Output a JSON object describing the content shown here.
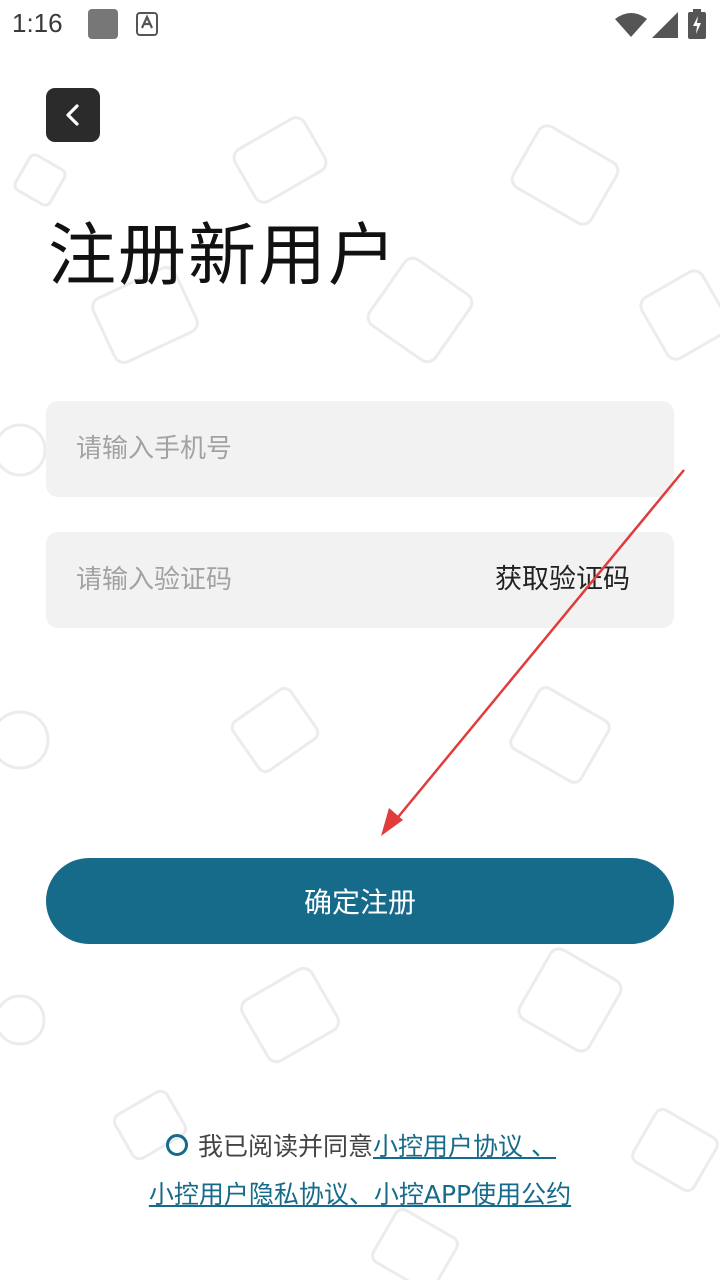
{
  "status_bar": {
    "time": "1:16"
  },
  "header": {
    "back_icon": "chevron-left-icon",
    "title": "注册新用户"
  },
  "form": {
    "phone_placeholder": "请输入手机号",
    "code_placeholder": "请输入验证码",
    "get_code_label": "获取验证码",
    "submit_label": "确定注册"
  },
  "agreement": {
    "prefix": "我已阅读并同意",
    "link1": "小控用户协议 、",
    "link2": "小控用户隐私协议、小控APP使用公约"
  },
  "colors": {
    "primary": "#176b8a",
    "annotation_arrow": "#e03c3c"
  }
}
